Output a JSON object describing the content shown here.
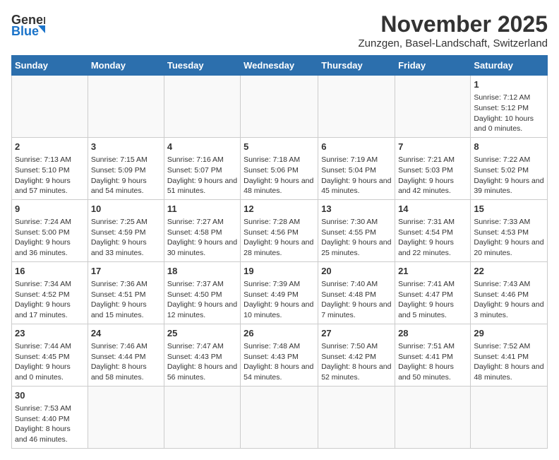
{
  "logo": {
    "line1": "General",
    "line2": "Blue"
  },
  "title": "November 2025",
  "subtitle": "Zunzgen, Basel-Landschaft, Switzerland",
  "weekdays": [
    "Sunday",
    "Monday",
    "Tuesday",
    "Wednesday",
    "Thursday",
    "Friday",
    "Saturday"
  ],
  "weeks": [
    [
      {
        "day": "",
        "info": ""
      },
      {
        "day": "",
        "info": ""
      },
      {
        "day": "",
        "info": ""
      },
      {
        "day": "",
        "info": ""
      },
      {
        "day": "",
        "info": ""
      },
      {
        "day": "",
        "info": ""
      },
      {
        "day": "1",
        "info": "Sunrise: 7:12 AM\nSunset: 5:12 PM\nDaylight: 10 hours and 0 minutes."
      }
    ],
    [
      {
        "day": "2",
        "info": "Sunrise: 7:13 AM\nSunset: 5:10 PM\nDaylight: 9 hours and 57 minutes."
      },
      {
        "day": "3",
        "info": "Sunrise: 7:15 AM\nSunset: 5:09 PM\nDaylight: 9 hours and 54 minutes."
      },
      {
        "day": "4",
        "info": "Sunrise: 7:16 AM\nSunset: 5:07 PM\nDaylight: 9 hours and 51 minutes."
      },
      {
        "day": "5",
        "info": "Sunrise: 7:18 AM\nSunset: 5:06 PM\nDaylight: 9 hours and 48 minutes."
      },
      {
        "day": "6",
        "info": "Sunrise: 7:19 AM\nSunset: 5:04 PM\nDaylight: 9 hours and 45 minutes."
      },
      {
        "day": "7",
        "info": "Sunrise: 7:21 AM\nSunset: 5:03 PM\nDaylight: 9 hours and 42 minutes."
      },
      {
        "day": "8",
        "info": "Sunrise: 7:22 AM\nSunset: 5:02 PM\nDaylight: 9 hours and 39 minutes."
      }
    ],
    [
      {
        "day": "9",
        "info": "Sunrise: 7:24 AM\nSunset: 5:00 PM\nDaylight: 9 hours and 36 minutes."
      },
      {
        "day": "10",
        "info": "Sunrise: 7:25 AM\nSunset: 4:59 PM\nDaylight: 9 hours and 33 minutes."
      },
      {
        "day": "11",
        "info": "Sunrise: 7:27 AM\nSunset: 4:58 PM\nDaylight: 9 hours and 30 minutes."
      },
      {
        "day": "12",
        "info": "Sunrise: 7:28 AM\nSunset: 4:56 PM\nDaylight: 9 hours and 28 minutes."
      },
      {
        "day": "13",
        "info": "Sunrise: 7:30 AM\nSunset: 4:55 PM\nDaylight: 9 hours and 25 minutes."
      },
      {
        "day": "14",
        "info": "Sunrise: 7:31 AM\nSunset: 4:54 PM\nDaylight: 9 hours and 22 minutes."
      },
      {
        "day": "15",
        "info": "Sunrise: 7:33 AM\nSunset: 4:53 PM\nDaylight: 9 hours and 20 minutes."
      }
    ],
    [
      {
        "day": "16",
        "info": "Sunrise: 7:34 AM\nSunset: 4:52 PM\nDaylight: 9 hours and 17 minutes."
      },
      {
        "day": "17",
        "info": "Sunrise: 7:36 AM\nSunset: 4:51 PM\nDaylight: 9 hours and 15 minutes."
      },
      {
        "day": "18",
        "info": "Sunrise: 7:37 AM\nSunset: 4:50 PM\nDaylight: 9 hours and 12 minutes."
      },
      {
        "day": "19",
        "info": "Sunrise: 7:39 AM\nSunset: 4:49 PM\nDaylight: 9 hours and 10 minutes."
      },
      {
        "day": "20",
        "info": "Sunrise: 7:40 AM\nSunset: 4:48 PM\nDaylight: 9 hours and 7 minutes."
      },
      {
        "day": "21",
        "info": "Sunrise: 7:41 AM\nSunset: 4:47 PM\nDaylight: 9 hours and 5 minutes."
      },
      {
        "day": "22",
        "info": "Sunrise: 7:43 AM\nSunset: 4:46 PM\nDaylight: 9 hours and 3 minutes."
      }
    ],
    [
      {
        "day": "23",
        "info": "Sunrise: 7:44 AM\nSunset: 4:45 PM\nDaylight: 9 hours and 0 minutes."
      },
      {
        "day": "24",
        "info": "Sunrise: 7:46 AM\nSunset: 4:44 PM\nDaylight: 8 hours and 58 minutes."
      },
      {
        "day": "25",
        "info": "Sunrise: 7:47 AM\nSunset: 4:43 PM\nDaylight: 8 hours and 56 minutes."
      },
      {
        "day": "26",
        "info": "Sunrise: 7:48 AM\nSunset: 4:43 PM\nDaylight: 8 hours and 54 minutes."
      },
      {
        "day": "27",
        "info": "Sunrise: 7:50 AM\nSunset: 4:42 PM\nDaylight: 8 hours and 52 minutes."
      },
      {
        "day": "28",
        "info": "Sunrise: 7:51 AM\nSunset: 4:41 PM\nDaylight: 8 hours and 50 minutes."
      },
      {
        "day": "29",
        "info": "Sunrise: 7:52 AM\nSunset: 4:41 PM\nDaylight: 8 hours and 48 minutes."
      }
    ],
    [
      {
        "day": "30",
        "info": "Sunrise: 7:53 AM\nSunset: 4:40 PM\nDaylight: 8 hours and 46 minutes."
      },
      {
        "day": "",
        "info": ""
      },
      {
        "day": "",
        "info": ""
      },
      {
        "day": "",
        "info": ""
      },
      {
        "day": "",
        "info": ""
      },
      {
        "day": "",
        "info": ""
      },
      {
        "day": "",
        "info": ""
      }
    ]
  ]
}
